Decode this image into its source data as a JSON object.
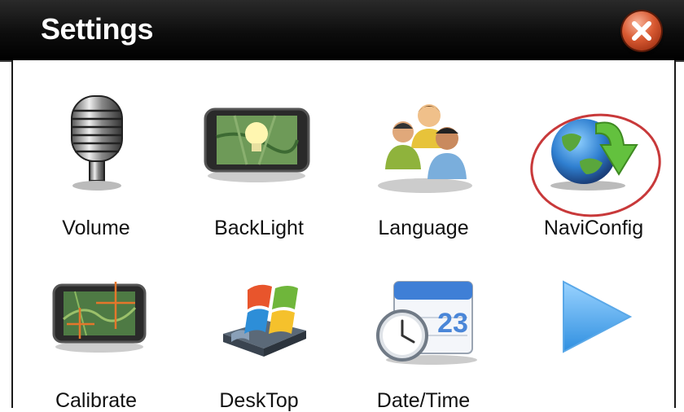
{
  "window": {
    "title": "Settings"
  },
  "buttons": {
    "close": "close"
  },
  "items": [
    {
      "label": "Volume",
      "icon": "microphone-icon"
    },
    {
      "label": "BackLight",
      "icon": "lightbulb-screen-icon"
    },
    {
      "label": "Language",
      "icon": "people-icon"
    },
    {
      "label": "NaviConfig",
      "icon": "globe-arrow-icon"
    },
    {
      "label": "Calibrate",
      "icon": "map-crosshair-icon"
    },
    {
      "label": "DeskTop",
      "icon": "windows-desktop-icon"
    },
    {
      "label": "Date/Time",
      "icon": "calendar-clock-icon"
    },
    {
      "label": "",
      "icon": "next-page-arrow-icon"
    }
  ],
  "calendar": {
    "day": "23"
  },
  "colors": {
    "titlebar": "#000000",
    "highlight": "#c8393a",
    "arrow": "#4aa3e6"
  }
}
